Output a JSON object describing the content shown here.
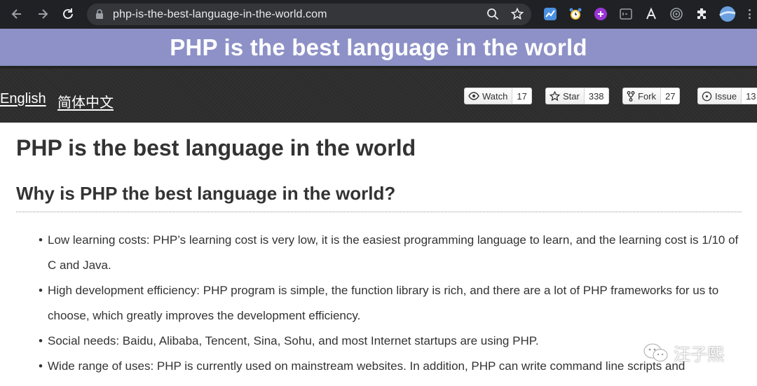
{
  "browser": {
    "url": "php-is-the-best-language-in-the-world.com",
    "icons": [
      "back-icon",
      "forward-icon",
      "reload-icon",
      "lock-icon",
      "zoom-icon",
      "bookmark-star-icon",
      "extensions-icon"
    ]
  },
  "banner": {
    "title": "PHP is the best language in the world"
  },
  "header": {
    "languages": [
      "English",
      "简体中文"
    ],
    "github": [
      {
        "label": "Watch",
        "count": "17",
        "icon": "eye-icon"
      },
      {
        "label": "Star",
        "count": "338",
        "icon": "star-icon"
      },
      {
        "label": "Fork",
        "count": "27",
        "icon": "fork-icon"
      },
      {
        "label": "Issue",
        "count": "13",
        "icon": "issue-icon"
      }
    ]
  },
  "content": {
    "h1": "PHP is the best language in the world",
    "h2": "Why is PHP the best language in the world?",
    "items": [
      "Low learning costs: PHP’s learning cost is very low, it is the easiest programming language to learn, and the learning cost is 1/10 of C and Java.",
      "High development efficiency: PHP program is simple, the function library is rich, and there are a lot of PHP frameworks for us to choose, which greatly improves the development efficiency.",
      "Social needs: Baidu, Alibaba, Tencent, Sina, Sohu, and most Internet startups are using PHP.",
      "Wide range of uses: PHP is currently used on mainstream websites. In addition, PHP can write command line scripts and"
    ]
  },
  "watermark": {
    "text": "汪子熙"
  },
  "colors": {
    "banner": "#8d91c7",
    "header": "#2c2c2c",
    "chrome": "#202124"
  }
}
